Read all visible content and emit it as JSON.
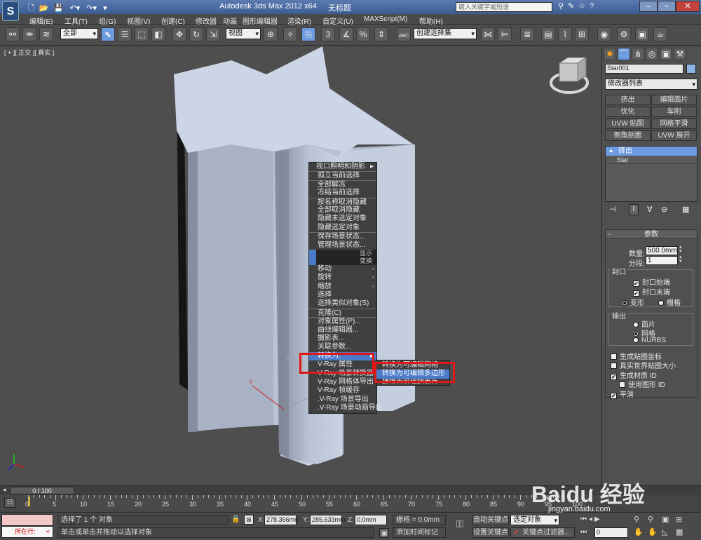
{
  "app": {
    "title": "Autodesk 3ds Max  2012 x64",
    "doc": "无标题",
    "search_placeholder": "键入关键字或短语"
  },
  "menu": [
    "编辑(E)",
    "工具(T)",
    "组(G)",
    "视图(V)",
    "创建(C)",
    "修改器",
    "动画",
    "图形编辑器",
    "渲染(R)",
    "自定义(U)",
    "MAXScript(M)",
    "帮助(H)"
  ],
  "toolbar": {
    "filter": "全部",
    "ref_coord": "视图",
    "selection_set": "创建选择集",
    "snap_3": "3",
    "snap_pct": "%",
    "abc": "ABC"
  },
  "viewport": {
    "label": "[ + ][ 正交 ][ 真实 ]",
    "axis_y": "Y",
    "axis_x": "X"
  },
  "context_menu": {
    "items_top": [
      "视口照明和阴影",
      "孤立当前选择",
      "全部解冻",
      "冻结当前选择",
      "按名称取消隐藏",
      "全部取消隐藏",
      "隐藏未选定对象",
      "隐藏选定对象",
      "保存场景状态...",
      "管理场景状态..."
    ],
    "hdr1": "显示",
    "hdr2": "变换",
    "items_bottom": [
      "移动",
      "旋转",
      "缩放",
      "选择",
      "选择类似对象(S)",
      "克隆(C)",
      "对象属性(P)...",
      "曲线编辑器...",
      "摄影表...",
      "关联参数...",
      "转换为:",
      "V-Ray 属性",
      "V-Ray 场景转换器",
      "V-Ray 网格体导出",
      "V-Ray 帧缓存",
      ".V-Ray 场景导出",
      ".V-Ray 场景动画导出"
    ],
    "submenu": [
      "转换为可编辑网格",
      "转换为可编辑多边形",
      "转换为可编辑面片"
    ]
  },
  "command_panel": {
    "object_name": "Star001",
    "modifier_list": "修改器列表",
    "buttons": [
      "挤出",
      "编辑面片",
      "优化",
      "车削",
      "UVW 贴图",
      "网格平滑",
      "倒角剖面",
      "UVW 展开"
    ],
    "stack": [
      "挤出",
      "Star"
    ],
    "params_title": "参数",
    "amount_label": "数量:",
    "amount_value": "500.0mm",
    "segments_label": "分段:",
    "segments_value": "1",
    "cap_group": "封口",
    "cap_start": "封口始端",
    "cap_end": "封口末端",
    "morph": "变形",
    "grid": "栅格",
    "output_group": "输出",
    "out_patch": "面片",
    "out_mesh": "网格",
    "out_nurbs": "NURBS",
    "gen_mapping": "生成贴图坐标",
    "real_world": "真实世界贴图大小",
    "gen_matid": "生成材质 ID",
    "use_shape_id": "使用图形 ID",
    "smooth": "平滑"
  },
  "timeline": {
    "frame": "0 / 100",
    "ticks": [
      "0",
      "5",
      "10",
      "15",
      "20",
      "25",
      "30",
      "35",
      "40",
      "45",
      "50",
      "55",
      "60",
      "65",
      "70",
      "75",
      "80",
      "85",
      "90",
      "95",
      "100"
    ]
  },
  "status": {
    "running": "所在行:",
    "selected": "选择了 1 个 对象",
    "hint": "单击或单击并拖动以选择对象",
    "x_label": "X:",
    "x_value": "278.366mm",
    "y_label": "Y:",
    "y_value": "285.633mm",
    "z_label": "Z:",
    "z_value": "0.0mm",
    "grid": "栅格 = 0.0mm",
    "add_time_tag": "添加时间标记",
    "auto_key": "自动关键点",
    "selected_obj": "选定对象",
    "set_key": "设置关键点",
    "key_filters": "关键点过滤器...",
    "frame_field": "0"
  },
  "watermark": "Baidu 经验",
  "watermark_url": "jingyan.baidu.com"
}
